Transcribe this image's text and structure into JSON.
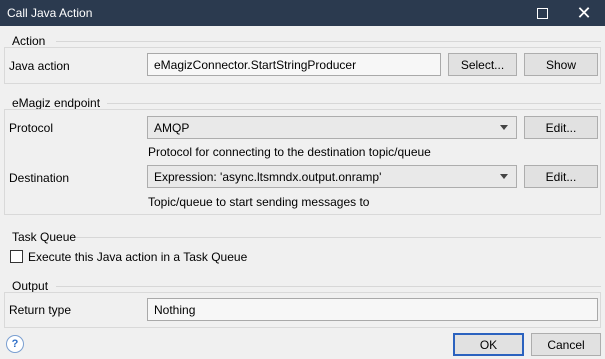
{
  "window": {
    "title": "Call Java Action",
    "maximize_icon": "maximize-icon",
    "close_icon": "close-icon"
  },
  "action_group": {
    "label": "Action",
    "java_action_label": "Java action",
    "java_action_value": "eMagizConnector.StartStringProducer",
    "select_button": "Select...",
    "show_button": "Show"
  },
  "endpoint_group": {
    "label": "eMagiz endpoint",
    "protocol_label": "Protocol",
    "protocol_value": "AMQP",
    "protocol_edit": "Edit...",
    "protocol_hint": "Protocol for connecting to the destination topic/queue",
    "destination_label": "Destination",
    "destination_value": "Expression: 'async.ltsmndx.output.onramp'",
    "destination_edit": "Edit...",
    "destination_hint": "Topic/queue to start sending messages to"
  },
  "task_queue_group": {
    "label": "Task Queue",
    "checkbox_label": "Execute this Java action in a Task Queue",
    "checked": false
  },
  "output_group": {
    "label": "Output",
    "return_type_label": "Return type",
    "return_type_value": "Nothing"
  },
  "footer": {
    "help_icon": "help-icon",
    "help_glyph": "?",
    "ok_button": "OK",
    "cancel_button": "Cancel"
  },
  "colors": {
    "titlebar": "#2b3a4f",
    "default_button_border": "#2b62bf"
  }
}
